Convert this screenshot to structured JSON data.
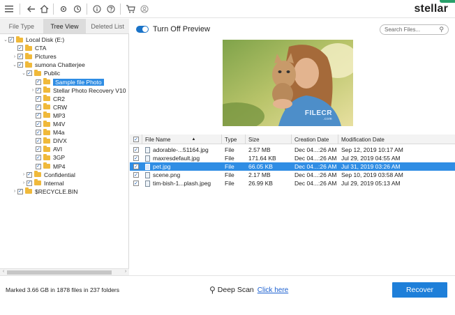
{
  "toolbar": {
    "icons": [
      "menu-icon",
      "back-icon",
      "home-icon",
      "settings-icon",
      "history-icon",
      "info-icon",
      "help-icon",
      "cart-icon",
      "account-icon"
    ],
    "brand": "stellar"
  },
  "tabs": [
    {
      "label": "File Type",
      "active": false
    },
    {
      "label": "Tree View",
      "active": true
    },
    {
      "label": "Deleted List",
      "active": false
    }
  ],
  "tree": [
    {
      "label": "Local Disk (E:)",
      "level": 0,
      "chevron": "v",
      "checked": true
    },
    {
      "label": "CTA",
      "level": 1,
      "chevron": "",
      "checked": true
    },
    {
      "label": "Pictures",
      "level": 1,
      "chevron": ">",
      "checked": true
    },
    {
      "label": "sumona Chatterjee",
      "level": 1,
      "chevron": "v",
      "checked": true
    },
    {
      "label": "Public",
      "level": 2,
      "chevron": "v",
      "checked": true
    },
    {
      "label": "Sample file Photo",
      "level": 3,
      "chevron": "",
      "checked": true,
      "selected": true
    },
    {
      "label": "Stellar Photo Recovery V10",
      "level": 3,
      "chevron": ">",
      "checked": true
    },
    {
      "label": "CR2",
      "level": 3,
      "chevron": "",
      "checked": true
    },
    {
      "label": "CRW",
      "level": 3,
      "chevron": "",
      "checked": true
    },
    {
      "label": "MP3",
      "level": 3,
      "chevron": "",
      "checked": true
    },
    {
      "label": "M4V",
      "level": 3,
      "chevron": "",
      "checked": true
    },
    {
      "label": "M4a",
      "level": 3,
      "chevron": "",
      "checked": true
    },
    {
      "label": "DIVX",
      "level": 3,
      "chevron": "",
      "checked": true
    },
    {
      "label": "AVI",
      "level": 3,
      "chevron": "",
      "checked": true
    },
    {
      "label": "3GP",
      "level": 3,
      "chevron": "",
      "checked": true
    },
    {
      "label": "MP4",
      "level": 3,
      "chevron": "",
      "checked": true
    },
    {
      "label": "Confidential",
      "level": 2,
      "chevron": ">",
      "checked": true
    },
    {
      "label": "Internal",
      "level": 2,
      "chevron": ">",
      "checked": true
    },
    {
      "label": "$RECYCLE.BIN",
      "level": 1,
      "chevron": ">",
      "checked": true
    }
  ],
  "preview": {
    "toggle_label": "Turn Off Preview",
    "search_placeholder": "Search Files...",
    "watermark": "FILECR",
    "watermark_sub": ".com"
  },
  "table": {
    "headers": [
      "File Name",
      "Type",
      "Size",
      "Creation Date",
      "Modification Date"
    ],
    "rows": [
      {
        "name": "adorable-...51164.jpg",
        "type": "File",
        "size": "2.57 MB",
        "created": "Dec 04...:26 AM",
        "modified": "Sep 12, 2019 10:17 AM",
        "selected": false
      },
      {
        "name": "maxresdefault.jpg",
        "type": "File",
        "size": "171.64 KB",
        "created": "Dec 04...:26 AM",
        "modified": "Jul 29, 2019 04:55 AM",
        "selected": false
      },
      {
        "name": "pet.jpg",
        "type": "File",
        "size": "66.05 KB",
        "created": "Dec 04...:26 AM",
        "modified": "Jul 31, 2019 03:26 AM",
        "selected": true
      },
      {
        "name": "scene.png",
        "type": "File",
        "size": "2.17 MB",
        "created": "Dec 04...:26 AM",
        "modified": "Sep 10, 2019 03:58 AM",
        "selected": false
      },
      {
        "name": "tim-bish-1...plash.jpeg",
        "type": "File",
        "size": "26.99 KB",
        "created": "Dec 04...:26 AM",
        "modified": "Jul 29, 2019 05:13 AM",
        "selected": false
      }
    ]
  },
  "status": {
    "marked": "Marked 3.66 GB in 1878 files in 237 folders",
    "deep_scan": "Deep Scan",
    "click_here": "Click here",
    "recover": "Recover"
  },
  "colors": {
    "accent": "#1e7fd9",
    "selection": "#2f8de4",
    "folder": "#f0b93a"
  }
}
